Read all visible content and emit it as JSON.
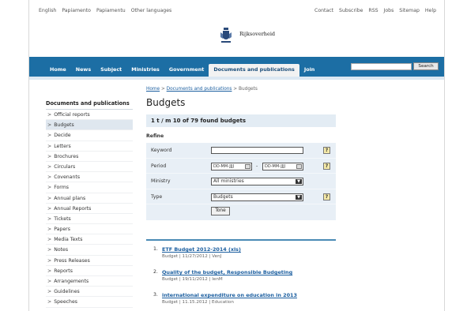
{
  "top_links": {
    "left": [
      "English",
      "Papiamento",
      "Papiamentu",
      "Other languages"
    ],
    "right": [
      "Contact",
      "Subscribe",
      "RSS",
      "Jobs",
      "Sitemap",
      "Help"
    ]
  },
  "logo": {
    "text": "Rijksoverheid"
  },
  "nav": {
    "items": [
      "Home",
      "News",
      "Subject",
      "Ministries",
      "Government",
      "Documents and publications",
      "Join"
    ],
    "active_index": 5,
    "search_button": "Search",
    "search_value": ""
  },
  "sidebar": {
    "title": "Documents and publications",
    "items": [
      "Official reports",
      "Budgets",
      "Decide",
      "Letters",
      "Brochures",
      "Circulars",
      "Covenants",
      "Forms",
      "Annual plans",
      "Annual Reports",
      "Tickets",
      "Papers",
      "Media Texts",
      "Notes",
      "Press Releases",
      "Reports",
      "Arrangements",
      "Guidelines",
      "Speeches"
    ],
    "active_index": 1
  },
  "main": {
    "breadcrumb": {
      "home": "Home",
      "sep": ">",
      "section": "Documents and publications",
      "current": "Budgets"
    },
    "title": "Budgets",
    "found": "1 t / m 10 of 79 found budgets",
    "refine": "Refine"
  },
  "form": {
    "keyword_label": "Keyword",
    "keyword_value": "",
    "period_label": "Period",
    "period_from": "DD-MM-JJJJ",
    "period_sep": "-",
    "period_to": "DD-MM-JJJJ",
    "ministry_label": "Ministry",
    "ministry_value": "All ministries",
    "type_label": "Type",
    "type_value": "Budgets",
    "help": "?",
    "submit": "Tone"
  },
  "results": [
    {
      "num": "1.",
      "title": "ETF Budget 2012-2014 (xls)",
      "meta": "Budget | 11/27/2012 | VenJ"
    },
    {
      "num": "2.",
      "title": "Quality of the budget, Responsible Budgeting",
      "meta": "Budget | 19/11/2012 | IenM"
    },
    {
      "num": "3.",
      "title": "international expenditure on education in 2013",
      "meta": "Budget | 11.15.2012 | Education"
    }
  ]
}
